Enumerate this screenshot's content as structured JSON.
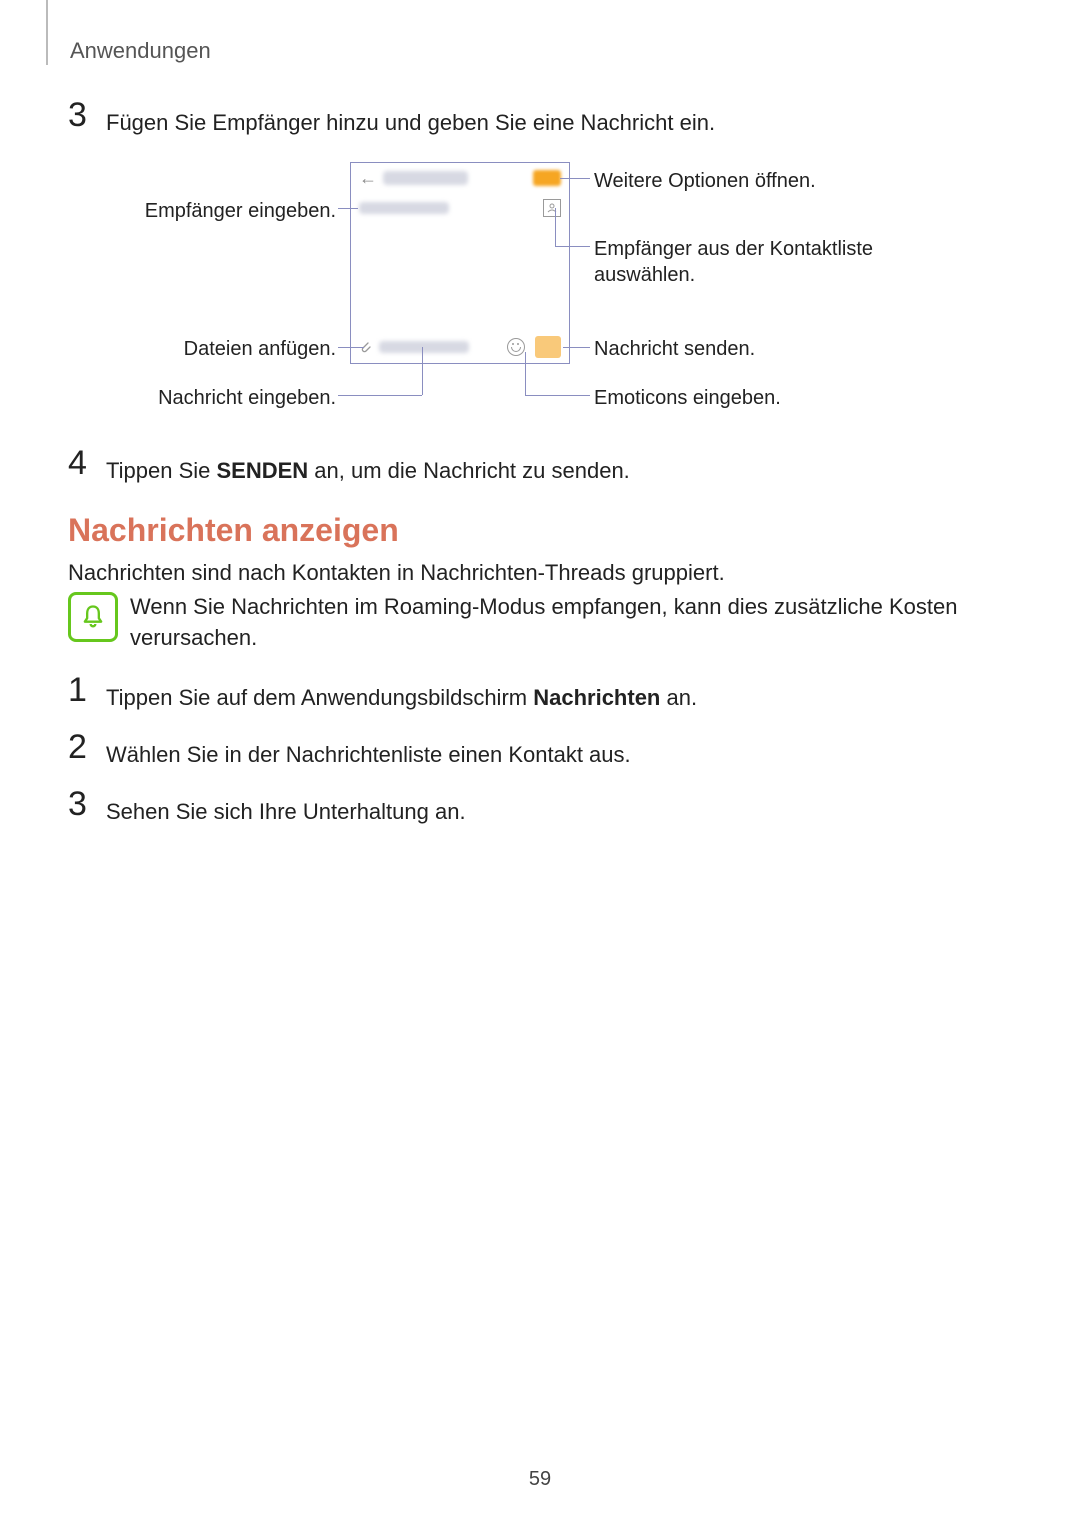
{
  "header": "Anwendungen",
  "step3": {
    "num": "3",
    "text": "Fügen Sie Empfänger hinzu und geben Sie eine Nachricht ein."
  },
  "step4": {
    "num": "4",
    "text_pre": "Tippen Sie ",
    "bold": "SENDEN",
    "text_post": " an, um die Nachricht zu senden."
  },
  "heading": "Nachrichten anzeigen",
  "intro": "Nachrichten sind nach Kontakten in Nachrichten-Threads gruppiert.",
  "note": "Wenn Sie Nachrichten im Roaming-Modus empfangen, kann dies zusätzliche Kosten verursachen.",
  "steps_b": {
    "s1_num": "1",
    "s1_pre": "Tippen Sie auf dem Anwendungsbildschirm ",
    "s1_bold": "Nachrichten",
    "s1_post": " an.",
    "s2_num": "2",
    "s2_text": "Wählen Sie in der Nachrichtenliste einen Kontakt aus.",
    "s3_num": "3",
    "s3_text": "Sehen Sie sich Ihre Unterhaltung an."
  },
  "callouts": {
    "recipients": "Empfänger eingeben.",
    "attach": "Dateien anfügen.",
    "enter_msg": "Nachricht eingeben.",
    "more": "Weitere Optionen öffnen.",
    "contacts": "Empfänger aus der Kontaktliste auswählen.",
    "send": "Nachricht senden.",
    "emoji": "Emoticons eingeben."
  },
  "phone": {
    "back": "←"
  },
  "pagenum": "59"
}
